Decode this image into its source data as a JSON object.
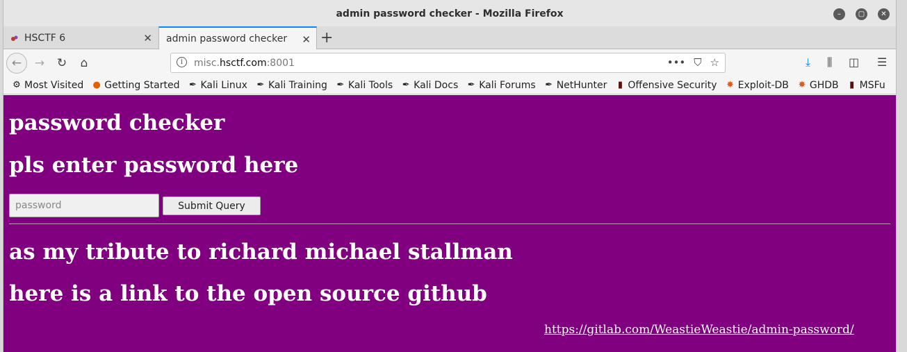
{
  "window": {
    "title": "admin password checker - Mozilla Firefox"
  },
  "tabs": [
    {
      "label": "HSCTF 6",
      "active": false
    },
    {
      "label": "admin password checker",
      "active": true
    }
  ],
  "urlbar": {
    "prefix": "misc.",
    "domain": "hsctf.com",
    "suffix": ":8001"
  },
  "bookmarks": [
    {
      "label": "Most Visited",
      "icon": "gear-icon"
    },
    {
      "label": "Getting Started",
      "icon": "firefox-icon"
    },
    {
      "label": "Kali Linux",
      "icon": "kali-dragon-icon"
    },
    {
      "label": "Kali Training",
      "icon": "kali-dragon-icon"
    },
    {
      "label": "Kali Tools",
      "icon": "kali-dragon-icon"
    },
    {
      "label": "Kali Docs",
      "icon": "kali-dragon-icon"
    },
    {
      "label": "Kali Forums",
      "icon": "kali-dragon-icon"
    },
    {
      "label": "NetHunter",
      "icon": "kali-dragon-icon"
    },
    {
      "label": "Offensive Security",
      "icon": "offsec-icon"
    },
    {
      "label": "Exploit-DB",
      "icon": "exploitdb-icon"
    },
    {
      "label": "GHDB",
      "icon": "exploitdb-icon"
    },
    {
      "label": "MSFu",
      "icon": "offsec-icon"
    }
  ],
  "page": {
    "heading1": "password checker",
    "heading2": "pls enter password here",
    "password_placeholder": "password",
    "submit_label": "Submit Query",
    "heading3": "as my tribute to richard michael stallman",
    "heading4": "here is a link to the open source github",
    "link_text": "https://gitlab.com/WeastieWeastie/admin-password/"
  },
  "colors": {
    "page_bg": "#800080",
    "accent": "#0a84ff"
  }
}
